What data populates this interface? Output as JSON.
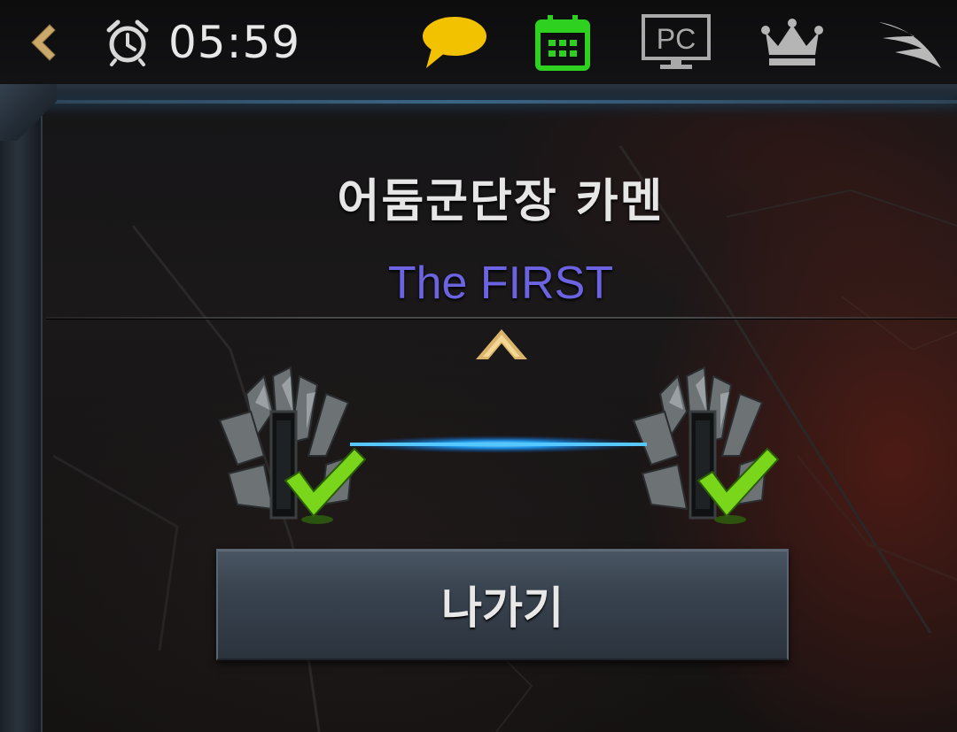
{
  "status_bar": {
    "time": "05:59",
    "icons": [
      "back-arrow-icon",
      "alarm-clock-icon",
      "chat-bubble-icon",
      "calendar-icon",
      "pc-monitor-icon",
      "crown-icon",
      "wing-icon"
    ],
    "colors": {
      "back_arrow": "#c9a86a",
      "chat": "#f2c200",
      "calendar": "#2ed11f",
      "gray_icon": "#a9a9a9"
    }
  },
  "dialog": {
    "title": "어둠군단장 카멘",
    "subtitle": "The FIRST",
    "subtitle_color": "#6b63e0",
    "party_status": [
      {
        "ready": true
      },
      {
        "ready": true
      }
    ],
    "exit_button_label": "나가기"
  }
}
